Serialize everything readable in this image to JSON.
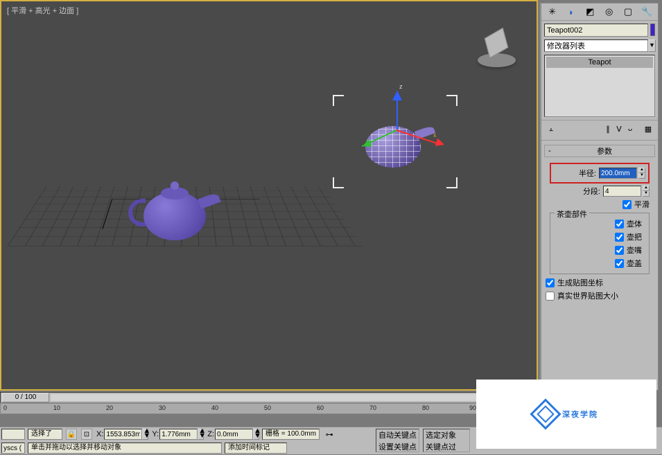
{
  "viewport": {
    "label": "[ 平滑 + 高光 + 边面 ]"
  },
  "gizmo": {
    "z": "z",
    "x": "x"
  },
  "panel": {
    "object_name": "Teapot002",
    "modifier_dropdown": "修改器列表",
    "stack_item": "Teapot",
    "rollout_params": "参数",
    "radius_label": "半径:",
    "radius_value": "200.0mm",
    "segments_label": "分段:",
    "segments_value": "4",
    "smooth_label": "平滑",
    "group_parts": "茶壶部件",
    "part_body": "壶体",
    "part_handle": "壶把",
    "part_spout": "壶嘴",
    "part_lid": "壶盖",
    "gen_mapping": "生成贴图坐标",
    "real_world": "真实世界贴图大小"
  },
  "timeline": {
    "frame_indicator": "0 / 100",
    "ticks": [
      "0",
      "10",
      "20",
      "30",
      "40",
      "50",
      "60",
      "70",
      "80",
      "90"
    ]
  },
  "status": {
    "mini": "yscs (",
    "selected_label": "选择了",
    "x": "1553.853m",
    "y": "1.776mm",
    "z": "0.0mm",
    "grid": "栅格 = 100.0mm",
    "hint": "单击并拖动以选择并移动对象",
    "add_marker": "添加时间标记",
    "auto_key": "自动关键点",
    "set_key": "设置关键点",
    "sel_obj": "选定对象",
    "key_filter": "关键点过"
  },
  "watermark": {
    "text": "深夜学院"
  }
}
